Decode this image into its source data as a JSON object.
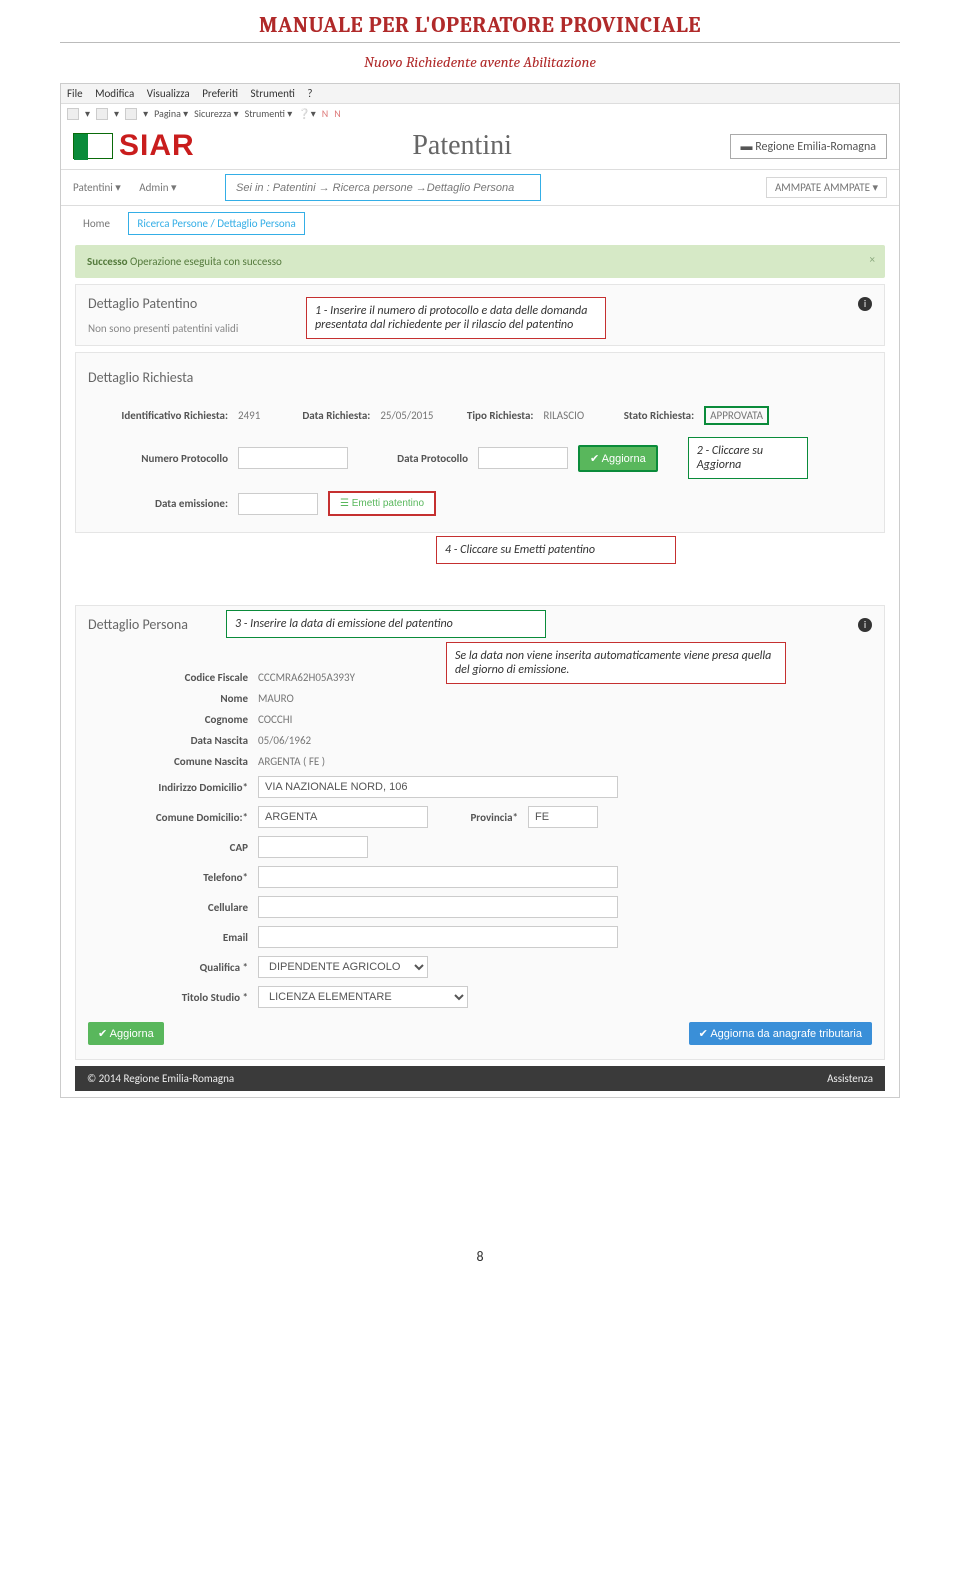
{
  "doc": {
    "title": "MANUALE PER L'OPERATORE PROVINCIALE",
    "subtitle": "Nuovo Richiedente avente Abilitazione",
    "page_number": "8"
  },
  "menubar": {
    "items": [
      "File",
      "Modifica",
      "Visualizza",
      "Preferiti",
      "Strumenti",
      "?"
    ]
  },
  "toolbar": {
    "pagina": "Pagina ▾",
    "sicurezza": "Sicurezza ▾",
    "strumenti": "Strumenti ▾"
  },
  "header": {
    "logo": "SIAR",
    "title": "Patentini",
    "region": "Regione Emilia-Romagna"
  },
  "nav": {
    "left": [
      "Patentini ▾",
      "Admin ▾"
    ],
    "right": "AMMPATE AMMPATE ▾"
  },
  "breadcrumb": {
    "home": "Home",
    "path": "Ricerca Persone  /  Dettaglio Persona"
  },
  "breadcrumb_anno": "Sei in :  Patentini → Ricerca persone →Dettaglio Persona",
  "alert": {
    "label": "Successo",
    "text": "Operazione eseguita con successo",
    "close": "×"
  },
  "patentino": {
    "heading": "Dettaglio Patentino",
    "empty": "Non sono presenti patentini validi"
  },
  "richiesta": {
    "heading": "Dettaglio Richiesta",
    "id_label": "Identificativo Richiesta:",
    "id_value": "2491",
    "data_label": "Data Richiesta:",
    "data_value": "25/05/2015",
    "tipo_label": "Tipo Richiesta:",
    "tipo_value": "RILASCIO",
    "stato_label": "Stato Richiesta:",
    "stato_value": "APPROVATA",
    "num_prot_label": "Numero Protocollo",
    "data_prot_label": "Data Protocollo",
    "aggiorna_btn": "✔  Aggiorna",
    "data_em_label": "Data emissione:",
    "emetti_btn": "☰   Emetti   patentino"
  },
  "anno": {
    "one": "1  -  Inserire il numero di protocollo e data delle domanda presentata dal richiedente per il rilascio del patentino",
    "two": "2  -  Cliccare su Aggiorna",
    "three": "3  -  Inserire la data di emissione   del patentino",
    "four": "4  -  Cliccare su   Emetti patentino",
    "note": "Se la data non viene inserita automaticamente viene presa quella del giorno di emissione."
  },
  "persona": {
    "heading": "Dettaglio Persona",
    "cf_label": "Codice Fiscale",
    "cf": "CCCMRA62H05A393Y",
    "nome_label": "Nome",
    "nome": "MAURO",
    "cognome_label": "Cognome",
    "cognome": "COCCHI",
    "nascita_label": "Data Nascita",
    "nascita": "05/06/1962",
    "comune_n_label": "Comune Nascita",
    "comune_n": "ARGENTA ( FE )",
    "indirizzo_label": "Indirizzo Domicilio*",
    "indirizzo": "VIA NAZIONALE NORD, 106",
    "comune_d_label": "Comune Domicilio:*",
    "comune_d": "ARGENTA",
    "provincia_label": "Provincia*",
    "provincia": "FE",
    "cap_label": "CAP",
    "cap": "",
    "telefono_label": "Telefono*",
    "telefono": "",
    "cellulare_label": "Cellulare",
    "cellulare": "",
    "email_label": "Email",
    "email": "",
    "qualifica_label": "Qualifica *",
    "qualifica": "DIPENDENTE AGRICOLO",
    "titolo_label": "Titolo Studio *",
    "titolo": "LICENZA ELEMENTARE",
    "aggiorna_btn": "✔  Aggiorna",
    "aggiorna_trib_btn": "✔   Aggiorna   da   anagrafe   tributaria"
  },
  "footer": {
    "left": "© 2014 Regione Emilia-Romagna",
    "right": "Assistenza"
  }
}
